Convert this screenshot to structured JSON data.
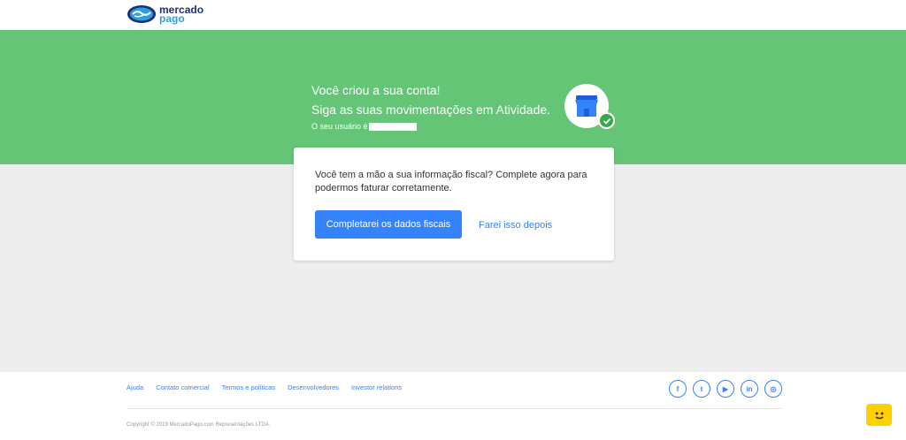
{
  "header": {
    "logo": {
      "line1": "mercado",
      "line2": "pago",
      "icon": "handshake-icon",
      "brand_navy": "#1e2f7a",
      "brand_blue": "#2d9fe0"
    }
  },
  "hero": {
    "title": "Você criou a sua conta!",
    "subtitle": "Siga as suas movimentações em Atividade.",
    "user_label": "O seu usuário é",
    "store_icon": "store-icon",
    "check_icon": "check-icon",
    "bg_color": "#64c576"
  },
  "card": {
    "message": "Você tem a mão a sua informação fiscal? Complete agora para podermos faturar corretamente.",
    "primary_button": "Completarei os dados fiscais",
    "secondary_link": "Farei isso depois",
    "accent": "#3483fa"
  },
  "footer": {
    "links": [
      "Ajuda",
      "Contato comercial",
      "Termos e políticas",
      "Desenvolvedores",
      "Investor relations"
    ],
    "social": [
      {
        "name": "facebook-icon",
        "glyph": "f"
      },
      {
        "name": "twitter-icon",
        "glyph": "t"
      },
      {
        "name": "youtube-icon",
        "glyph": "▶"
      },
      {
        "name": "linkedin-icon",
        "glyph": "in"
      },
      {
        "name": "instagram-icon",
        "glyph": "◎"
      }
    ],
    "copyright": "Copyright © 2019 MercadoPago.com Representações LTDA."
  },
  "chat_widget": {
    "icon": "chat-face-icon",
    "color": "#ffd000"
  }
}
